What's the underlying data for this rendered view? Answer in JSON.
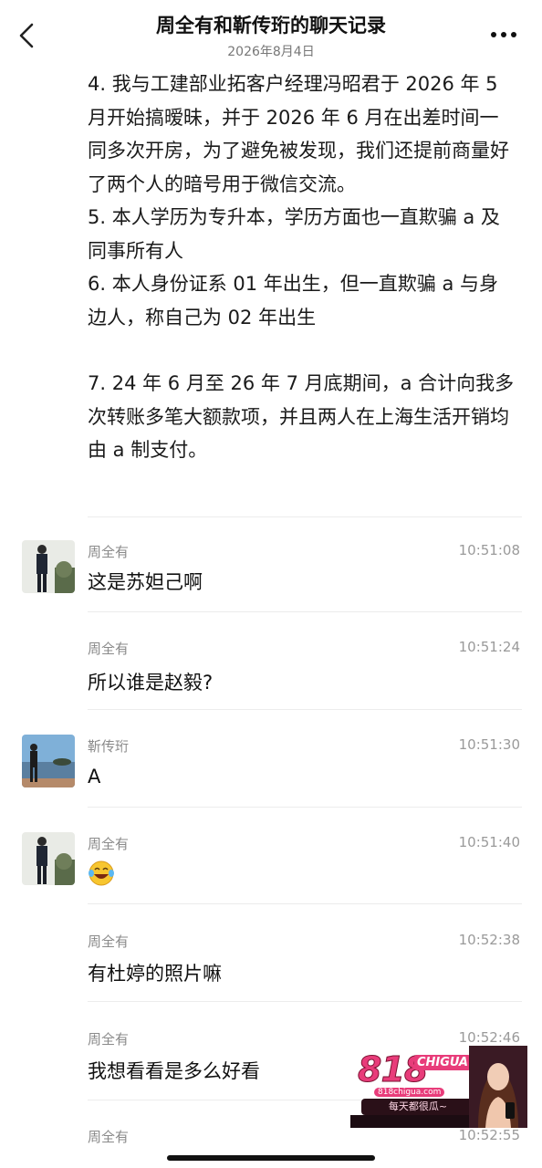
{
  "header": {
    "title": "周全有和靳传珩的聊天记录",
    "date": "2026年8月4日"
  },
  "body_text": {
    "para1": "4. 我与工建部业拓客户经理冯昭君于 2026 年 5 月开始搞暧昧，并于 2026 年 6 月在出差时间一同多次开房，为了避免被发现，我们还提前商量好了两个人的暗号用于微信交流。",
    "para2": "5. 本人学历为专升本，学历方面也一直欺骗 a 及同事所有人",
    "para3": "6. 本人身份证系 01 年出生，但一直欺骗 a 与身边人，称自己为 02 年出生",
    "para4": "7. 24 年 6 月至 26 年 7 月底期间，a 合计向我多次转账多笔大额款项，并且两人在上海生活开销均由 a 制支付。"
  },
  "messages": [
    {
      "sender": "周全有",
      "time": "10:51:08",
      "text": "这是苏妲己啊"
    },
    {
      "sender": "周全有",
      "time": "10:51:24",
      "text": "所以谁是赵毅?"
    },
    {
      "sender": "靳传珩",
      "time": "10:51:30",
      "text": "A"
    },
    {
      "sender": "周全有",
      "time": "10:51:40",
      "text": "",
      "emoji": "laughing-tears-emoji"
    },
    {
      "sender": "周全有",
      "time": "10:52:38",
      "text": "有杜婷的照片嘛"
    },
    {
      "sender": "周全有",
      "time": "10:52:46",
      "text": "我想看看是多么好看"
    },
    {
      "sender": "周全有",
      "time": "10:52:55",
      "text": ""
    }
  ],
  "ad": {
    "logo": "818",
    "brand": "CHIGUA",
    "url": "818chigua.com",
    "slogan": "每天都很瓜~"
  },
  "colors": {
    "accent_pink": "#e83c7a",
    "divider": "#ececec",
    "meta_text": "#8a8a8a"
  }
}
